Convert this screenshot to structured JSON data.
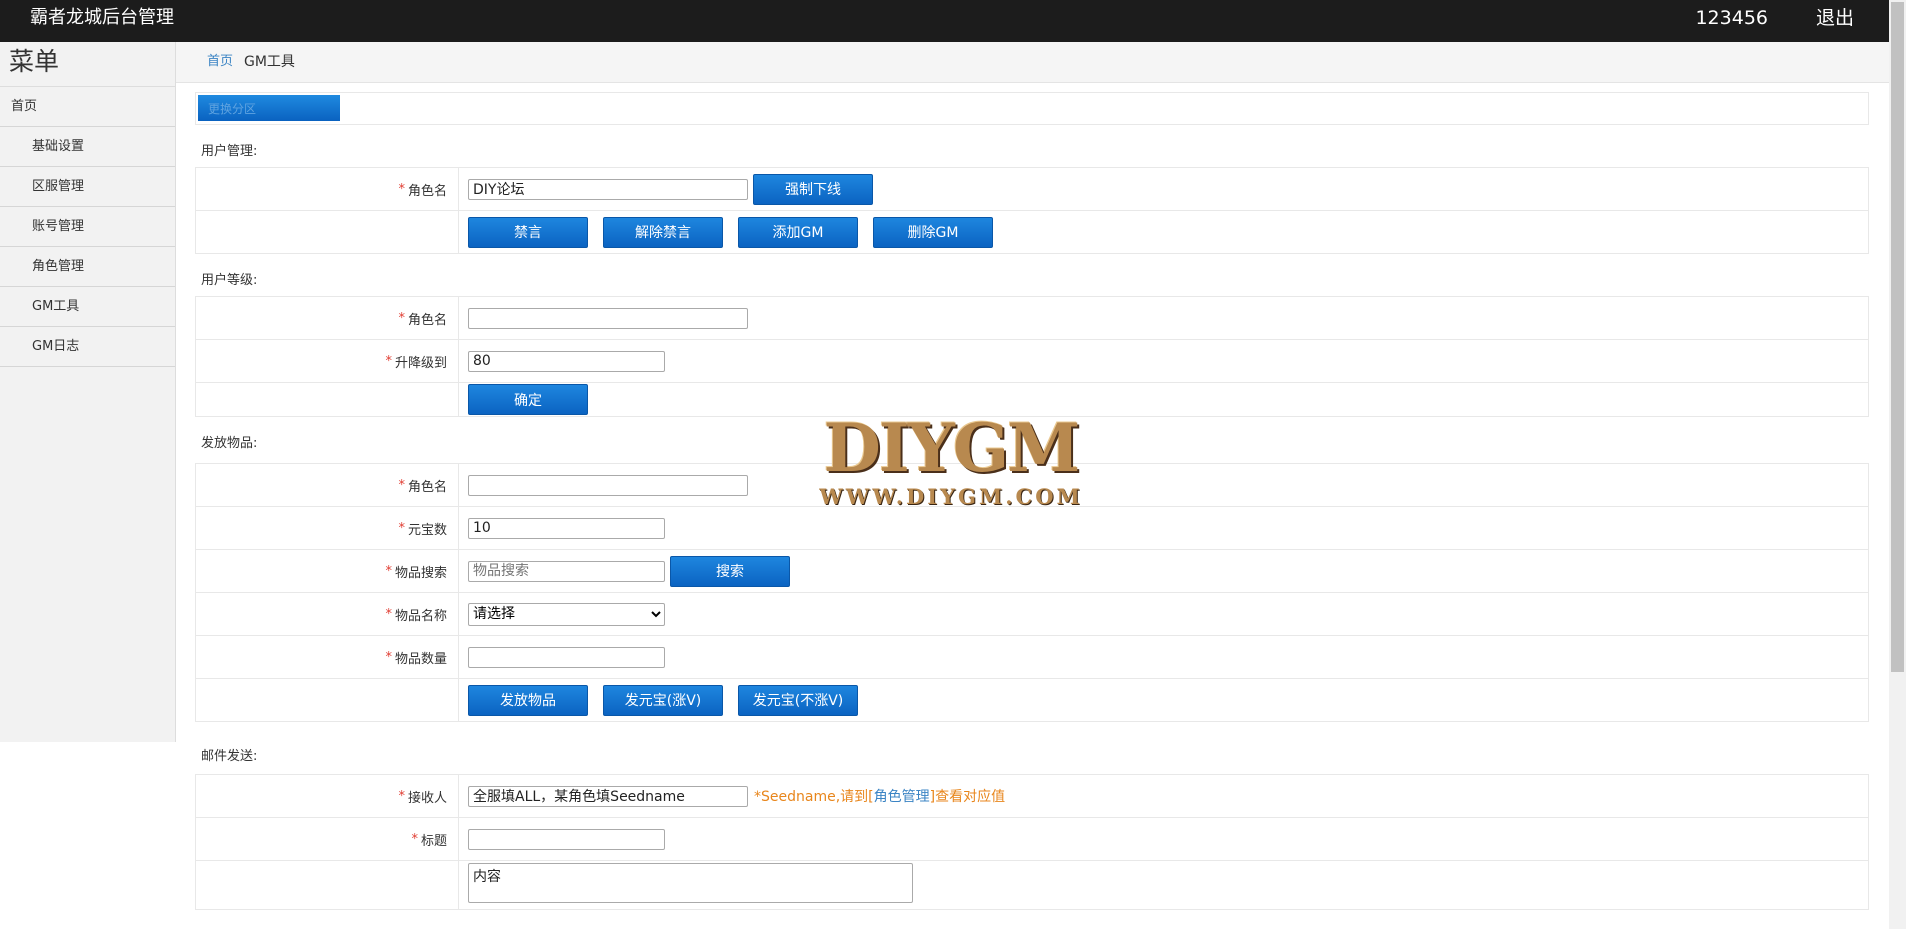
{
  "header": {
    "brand": "霸者龙城后台管理",
    "user": "123456",
    "logout": "退出"
  },
  "sidebar": {
    "title": "菜单",
    "items": [
      {
        "label": "首页"
      },
      {
        "label": "基础设置"
      },
      {
        "label": "区服管理"
      },
      {
        "label": "账号管理"
      },
      {
        "label": "角色管理"
      },
      {
        "label": "GM工具"
      },
      {
        "label": "GM日志"
      }
    ]
  },
  "breadcrumb": {
    "home": "首页",
    "current": "GM工具"
  },
  "zone": {
    "button": "更换分区"
  },
  "user_mgmt": {
    "title": "用户管理:",
    "role_label": "角色名",
    "role_value": "DIY论坛",
    "kick_button": "强制下线",
    "mute_button": "禁言",
    "unmute_button": "解除禁言",
    "add_gm_button": "添加GM",
    "del_gm_button": "删除GM"
  },
  "user_level": {
    "title": "用户等级:",
    "role_label": "角色名",
    "role_value": "",
    "level_label": "升降级到",
    "level_value": "80",
    "confirm_button": "确定"
  },
  "items_send": {
    "title": "发放物品:",
    "role_label": "角色名",
    "role_value": "",
    "yuanbao_label": "元宝数",
    "yuanbao_value": "10",
    "search_label": "物品搜索",
    "search_placeholder": "物品搜索",
    "search_button": "搜索",
    "name_label": "物品名称",
    "name_selected": "请选择",
    "qty_label": "物品数量",
    "qty_value": "",
    "send_button": "发放物品",
    "yb_v_button": "发元宝(涨V)",
    "yb_nov_button": "发元宝(不涨V)"
  },
  "mail": {
    "title": "邮件发送:",
    "recipient_label": "接收人",
    "recipient_value": "全服填ALL，某角色填Seedname",
    "hint_prefix": "*Seedname,请到[",
    "hint_link": "角色管理",
    "hint_suffix": "]查看对应值",
    "subject_label": "标题",
    "subject_value": "",
    "content_value": "内容"
  },
  "watermark": {
    "big": "DIYGM",
    "small": "WWW.DIYGM.COM"
  },
  "colors": {
    "topbar": "#1c1c1c",
    "button": "#0b63c2",
    "link": "#3b84c4",
    "required": "#e03c31",
    "hint": "#e8861c"
  }
}
